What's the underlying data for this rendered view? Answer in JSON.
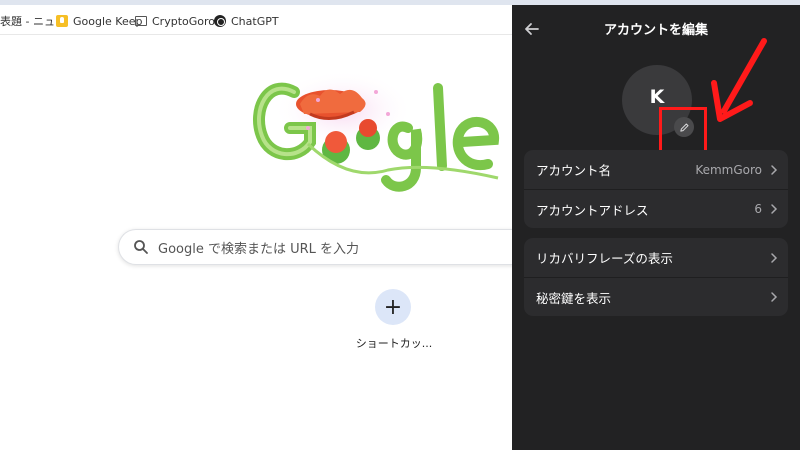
{
  "bookmarks": [
    {
      "label": "表題 - ニュ...",
      "icon": "news-icon"
    },
    {
      "label": "Google Keep",
      "icon": "keep-icon"
    },
    {
      "label": "CryptoGoros",
      "icon": "folder-icon"
    },
    {
      "label": "ChatGPT",
      "icon": "chatgpt-icon"
    }
  ],
  "newtab": {
    "search_placeholder": "Google で検索または URL を入力",
    "shortcut_add_symbol": "+",
    "shortcut_label": "ショートカッ..."
  },
  "panel": {
    "title": "アカウントを編集",
    "avatar_initial": "K",
    "rows": [
      {
        "label": "アカウント名",
        "value": "KemmGoro"
      },
      {
        "label": "アカウントアドレス",
        "value": "6"
      },
      {
        "label": "リカバリフレーズの表示",
        "value": ""
      },
      {
        "label": "秘密鍵を表示",
        "value": ""
      }
    ]
  },
  "colors": {
    "panel_bg": "#222223",
    "row_bg": "#2c2c2e",
    "highlight": "#ff1a1a"
  }
}
